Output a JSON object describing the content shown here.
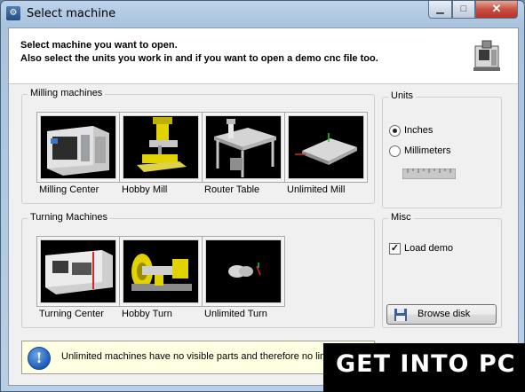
{
  "window": {
    "title": "Select machine"
  },
  "titlebar": {
    "minimize_icon": "minimize-icon",
    "maximize_icon": "maximize-icon",
    "close_icon": "close-icon"
  },
  "header": {
    "line1": "Select machine you want to open.",
    "line2": "Also select the units you work in and if you want to open a demo cnc file too."
  },
  "milling": {
    "title": "Milling machines",
    "items": [
      {
        "label": "Milling Center"
      },
      {
        "label": "Hobby Mill"
      },
      {
        "label": "Router Table"
      },
      {
        "label": "Unlimited Mill"
      }
    ]
  },
  "turning": {
    "title": "Turning Machines",
    "items": [
      {
        "label": "Turning Center"
      },
      {
        "label": "Hobby Turn"
      },
      {
        "label": "Unlimited Turn"
      }
    ]
  },
  "units": {
    "title": "Units",
    "inches": "Inches",
    "millimeters": "Millimeters",
    "selected": "Inches"
  },
  "misc": {
    "title": "Misc",
    "load_demo": "Load demo",
    "load_demo_checked": true,
    "browse": "Browse disk"
  },
  "info": {
    "text": "Unlimited machines have no visible parts and therefore no limits"
  },
  "watermark": {
    "text": "GET INTO PC"
  }
}
